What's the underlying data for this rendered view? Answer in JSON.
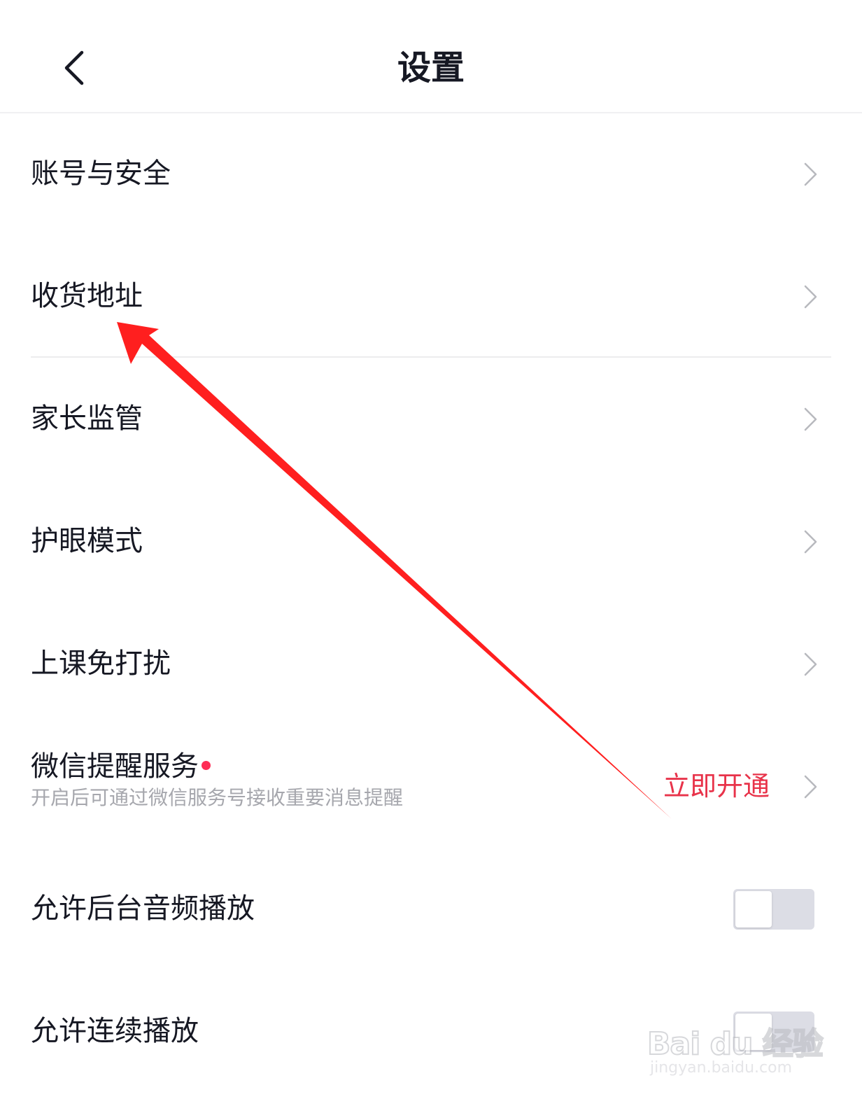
{
  "header": {
    "title": "设置",
    "back_icon": "chevron-left-icon"
  },
  "settings": {
    "account_security": "账号与安全",
    "shipping_address": "收货地址",
    "parental_control": "家长监管",
    "eye_protection": "护眼模式",
    "class_dnd": "上课免打扰",
    "wechat_reminder": {
      "label": "微信提醒服务",
      "subtitle": "开启后可通过微信服务号接收重要消息提醒",
      "action": "立即开通",
      "action_color": "#e8334a",
      "badge_color": "#fe2c55"
    },
    "background_audio": {
      "label": "允许后台音频播放",
      "enabled": false
    },
    "continuous_play": {
      "label": "允许连续播放",
      "enabled": false
    }
  },
  "annotation": {
    "arrow_color": "#ff1f1f"
  },
  "watermark": {
    "logo_text": "Bai du 经验",
    "url": "jingyan.baidu.com"
  }
}
